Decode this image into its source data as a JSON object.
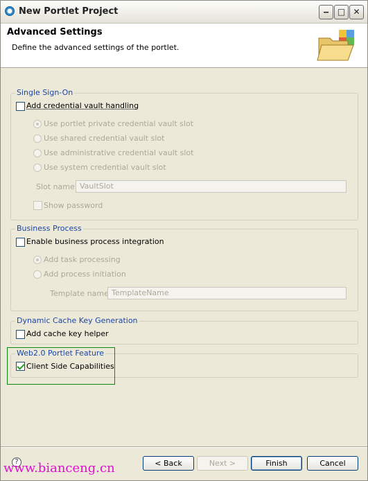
{
  "window": {
    "title": "New Portlet Project",
    "controls": {
      "minimize": "‒",
      "maximize": "□",
      "close": "✕"
    }
  },
  "header": {
    "title": "Advanced Settings",
    "description": "Define the advanced settings of the portlet."
  },
  "sso": {
    "legend": "Single Sign-On",
    "checkbox_label": "Add credential vault handling",
    "checked": false,
    "options": [
      "Use portlet private credential vault slot",
      "Use shared credential vault slot",
      "Use administrative credential vault slot",
      "Use system credential vault slot"
    ],
    "slot_label": "Slot name:",
    "slot_value": "VaultSlot",
    "show_password_label": "Show password"
  },
  "business": {
    "legend": "Business Process",
    "checkbox_label": "Enable business process integration",
    "checked": false,
    "options": [
      "Add task processing",
      "Add process initiation"
    ],
    "template_label": "Template name:",
    "template_value": "TemplateName"
  },
  "cache": {
    "legend": "Dynamic Cache Key Generation",
    "checkbox_label": "Add cache key helper",
    "checked": false
  },
  "web20": {
    "legend": "Web2.0 Portlet Feature",
    "checkbox_label": "Client Side Capabilities",
    "checked": true
  },
  "footer": {
    "help": "?",
    "back": "< Back",
    "next": "Next >",
    "finish": "Finish",
    "cancel": "Cancel"
  },
  "watermark": "www.bianceng.cn",
  "colors": {
    "legend": "#1c46a6",
    "highlight_border": "#0a8a0a",
    "watermark": "#e10fd0"
  }
}
